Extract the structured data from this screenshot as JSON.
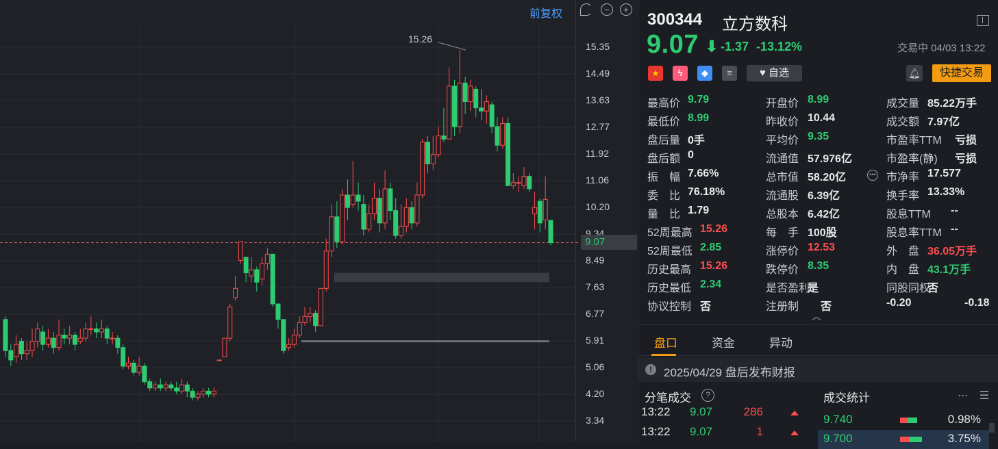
{
  "chart": {
    "restore_label": "前复权",
    "y_ticks": [
      "15.35",
      "14.49",
      "13.63",
      "12.77",
      "11.92",
      "11.06",
      "10.20",
      "9.34",
      "8.49",
      "7.63",
      "6.77",
      "5.91",
      "5.06",
      "4.20",
      "3.34"
    ],
    "current_price_tag": "9.07",
    "peak_label": "15.26",
    "up_color": "#ff4d4f",
    "down_color": "#2ecc71"
  },
  "chart_data": {
    "type": "candlestick",
    "y_range": [
      3.34,
      15.35
    ],
    "candles": [
      [
        6.6,
        5.6,
        6.7,
        5.4
      ],
      [
        5.6,
        5.3,
        5.8,
        5.1
      ],
      [
        5.4,
        5.8,
        6.1,
        5.2
      ],
      [
        5.9,
        5.5,
        6.0,
        5.3
      ],
      [
        5.5,
        5.6,
        5.9,
        5.3
      ],
      [
        5.6,
        5.9,
        6.3,
        5.4
      ],
      [
        5.9,
        6.3,
        6.5,
        5.7
      ],
      [
        6.2,
        5.8,
        6.4,
        5.6
      ],
      [
        5.8,
        6.0,
        6.3,
        5.7
      ],
      [
        6.0,
        5.7,
        6.2,
        5.5
      ],
      [
        5.7,
        6.1,
        6.6,
        5.6
      ],
      [
        6.1,
        6.0,
        6.3,
        5.8
      ],
      [
        6.0,
        6.1,
        6.4,
        5.8
      ],
      [
        6.1,
        5.8,
        6.2,
        5.6
      ],
      [
        5.9,
        6.0,
        6.3,
        5.8
      ],
      [
        6.0,
        6.3,
        6.5,
        5.9
      ],
      [
        6.3,
        6.3,
        6.7,
        6.1
      ],
      [
        6.3,
        6.2,
        6.5,
        6.0
      ],
      [
        6.2,
        6.3,
        6.6,
        6.0
      ],
      [
        6.3,
        6.0,
        6.4,
        5.8
      ],
      [
        6.0,
        6.0,
        6.2,
        5.8
      ],
      [
        6.0,
        5.7,
        6.1,
        5.5
      ],
      [
        5.7,
        5.1,
        5.8,
        5.0
      ],
      [
        5.1,
        5.2,
        5.4,
        5.0
      ],
      [
        5.2,
        4.9,
        5.3,
        4.8
      ],
      [
        4.9,
        5.1,
        5.4,
        4.8
      ],
      [
        5.1,
        4.6,
        5.2,
        4.5
      ],
      [
        4.6,
        4.4,
        4.7,
        4.3
      ],
      [
        4.4,
        4.5,
        4.6,
        4.3
      ],
      [
        4.5,
        4.4,
        4.7,
        4.3
      ],
      [
        4.4,
        4.5,
        4.6,
        4.3
      ],
      [
        4.5,
        4.4,
        4.6,
        4.3
      ],
      [
        4.4,
        4.3,
        4.6,
        4.2
      ],
      [
        4.3,
        4.5,
        4.7,
        4.2
      ],
      [
        4.5,
        4.3,
        4.6,
        4.1
      ],
      [
        4.3,
        4.1,
        4.4,
        4.0
      ],
      [
        4.1,
        4.2,
        4.3,
        4.0
      ],
      [
        4.2,
        4.3,
        4.4,
        4.1
      ],
      [
        4.3,
        4.2,
        4.4,
        4.1
      ],
      [
        4.2,
        4.3,
        4.4,
        4.1
      ],
      [
        5.3,
        5.3,
        5.3,
        5.3
      ],
      [
        5.4,
        6.0,
        6.0,
        5.4
      ],
      [
        6.0,
        7.0,
        7.1,
        5.9
      ],
      [
        7.3,
        7.6,
        8.0,
        7.2
      ],
      [
        8.5,
        9.1,
        9.1,
        8.4
      ],
      [
        8.6,
        8.1,
        8.6,
        7.8
      ],
      [
        8.0,
        8.2,
        8.6,
        7.8
      ],
      [
        8.2,
        7.8,
        8.3,
        7.5
      ],
      [
        7.9,
        8.4,
        8.6,
        7.7
      ],
      [
        8.4,
        8.7,
        8.9,
        8.2
      ],
      [
        8.7,
        7.1,
        8.7,
        7.0
      ],
      [
        7.1,
        6.6,
        7.1,
        6.3
      ],
      [
        6.6,
        5.6,
        6.6,
        5.5
      ],
      [
        5.7,
        5.8,
        6.0,
        5.6
      ],
      [
        5.8,
        6.1,
        6.3,
        5.7
      ],
      [
        6.1,
        6.5,
        6.7,
        6.0
      ],
      [
        6.5,
        6.7,
        7.0,
        6.4
      ],
      [
        6.7,
        6.8,
        7.0,
        6.5
      ],
      [
        6.8,
        6.4,
        6.9,
        6.2
      ],
      [
        6.4,
        7.6,
        7.6,
        6.4
      ],
      [
        7.6,
        8.8,
        9.2,
        7.5
      ],
      [
        8.8,
        9.9,
        10.3,
        8.6
      ],
      [
        9.9,
        9.1,
        10.4,
        8.9
      ],
      [
        9.1,
        10.6,
        10.8,
        9.0
      ],
      [
        10.6,
        10.2,
        11.1,
        9.8
      ],
      [
        10.3,
        10.6,
        11.7,
        10.2
      ],
      [
        10.6,
        10.4,
        11.0,
        10.1
      ],
      [
        10.3,
        9.5,
        10.6,
        9.3
      ],
      [
        9.5,
        10.0,
        10.3,
        9.4
      ],
      [
        10.0,
        10.5,
        11.0,
        9.8
      ],
      [
        10.5,
        9.7,
        10.8,
        9.4
      ],
      [
        9.7,
        10.8,
        11.4,
        9.5
      ],
      [
        10.8,
        10.1,
        11.0,
        9.8
      ],
      [
        10.1,
        9.3,
        10.5,
        9.2
      ],
      [
        9.3,
        9.6,
        10.3,
        9.2
      ],
      [
        9.6,
        10.2,
        10.5,
        9.4
      ],
      [
        10.2,
        9.7,
        10.4,
        9.5
      ],
      [
        9.7,
        10.6,
        11.0,
        9.6
      ],
      [
        10.6,
        12.3,
        12.4,
        10.5
      ],
      [
        12.3,
        11.6,
        12.5,
        11.3
      ],
      [
        11.6,
        11.9,
        12.5,
        11.4
      ],
      [
        11.9,
        12.5,
        12.8,
        11.8
      ],
      [
        12.5,
        12.4,
        13.4,
        12.3
      ],
      [
        12.4,
        14.1,
        14.7,
        12.4
      ],
      [
        14.1,
        12.8,
        14.3,
        12.5
      ],
      [
        12.8,
        14.2,
        15.26,
        12.6
      ],
      [
        14.2,
        13.6,
        14.4,
        13.2
      ],
      [
        13.6,
        14.1,
        14.3,
        13.3
      ],
      [
        14.0,
        13.4,
        14.1,
        13.1
      ],
      [
        13.4,
        13.3,
        14.0,
        13.0
      ],
      [
        13.3,
        13.6,
        13.8,
        12.9
      ],
      [
        13.5,
        12.8,
        13.6,
        12.6
      ],
      [
        12.8,
        12.2,
        13.1,
        12.0
      ],
      [
        12.2,
        12.9,
        13.1,
        12.1
      ],
      [
        12.9,
        10.9,
        13.1,
        10.9
      ],
      [
        10.9,
        11.0,
        11.3,
        10.8
      ],
      [
        11.0,
        11.0,
        11.2,
        10.7
      ],
      [
        10.9,
        11.2,
        11.5,
        10.8
      ],
      [
        11.2,
        10.8,
        11.3,
        10.7
      ],
      [
        10.0,
        10.2,
        10.7,
        9.5
      ],
      [
        10.4,
        9.7,
        10.5,
        9.4
      ],
      [
        9.8,
        10.46,
        11.2,
        9.5
      ],
      [
        9.79,
        9.07,
        9.79,
        8.99
      ]
    ],
    "price_lines": [
      9.07
    ],
    "shaded_bands": [
      [
        7.8,
        8.1
      ]
    ],
    "support_line": 5.9
  },
  "header": {
    "code": "300344",
    "name": "立方数科",
    "price": "9.07",
    "arrow": "⬇",
    "change": "-1.37",
    "change_pct": "-13.12%",
    "status": "交易中 04/03 13:22",
    "watch_label": "自选",
    "quick_trade_label": "快捷交易"
  },
  "stats": [
    [
      {
        "l": "最高价",
        "v": "9.79",
        "c": "g"
      },
      {
        "l": "开盘价",
        "v": "8.99",
        "c": "g"
      },
      {
        "l": "成交量",
        "v": "85.22万手",
        "c": "w"
      }
    ],
    [
      {
        "l": "最低价",
        "v": "8.99",
        "c": "g"
      },
      {
        "l": "昨收价",
        "v": "10.44",
        "c": "w"
      },
      {
        "l": "成交额",
        "v": "7.97亿",
        "c": "w"
      }
    ],
    [
      {
        "l": "盘后量",
        "v": "0手",
        "c": "w"
      },
      {
        "l": "平均价",
        "v": "9.35",
        "c": "g"
      },
      {
        "l": "市盈率TTM",
        "v": "亏损",
        "c": "w"
      }
    ],
    [
      {
        "l": "盘后额",
        "v": "0",
        "c": "w"
      },
      {
        "l": "流通值",
        "v": "57.976亿",
        "c": "w"
      },
      {
        "l": "市盈率(静)",
        "v": "亏损",
        "c": "w"
      }
    ],
    [
      {
        "l": "振　幅",
        "v": "7.66%",
        "c": "w"
      },
      {
        "l": "总市值",
        "v": "58.20亿",
        "c": "w"
      },
      {
        "l": "市净率",
        "v": "17.577",
        "c": "w"
      }
    ],
    [
      {
        "l": "委　比",
        "v": "76.18%",
        "c": "w"
      },
      {
        "l": "流通股",
        "v": "6.39亿",
        "c": "w"
      },
      {
        "l": "换手率",
        "v": "13.33%",
        "c": "w"
      }
    ],
    [
      {
        "l": "量　比",
        "v": "1.79",
        "c": "w"
      },
      {
        "l": "总股本",
        "v": "6.42亿",
        "c": "w"
      },
      {
        "l": "股息TTM",
        "v": "--",
        "c": "w"
      }
    ],
    [
      {
        "l": "52周最高",
        "v": "15.26",
        "c": "r"
      },
      {
        "l": "每　手",
        "v": "100股",
        "c": "w"
      },
      {
        "l": "股息率TTM",
        "v": "--",
        "c": "w"
      }
    ],
    [
      {
        "l": "52周最低",
        "v": "2.85",
        "c": "g"
      },
      {
        "l": "涨停价",
        "v": "12.53",
        "c": "r"
      },
      {
        "l": "外　盘",
        "v": "36.05万手",
        "c": "r"
      }
    ],
    [
      {
        "l": "历史最高",
        "v": "15.26",
        "c": "r"
      },
      {
        "l": "跌停价",
        "v": "8.35",
        "c": "g"
      },
      {
        "l": "内　盘",
        "v": "43.1万手",
        "c": "g"
      }
    ],
    [
      {
        "l": "历史最低",
        "v": "2.34",
        "c": "g"
      },
      {
        "l": "是否盈利",
        "v": "是",
        "c": "w"
      },
      {
        "l": "同股同权",
        "v": "否",
        "c": "w"
      }
    ],
    [
      {
        "l": "协议控制",
        "v": "否",
        "c": "w"
      },
      {
        "l": "注册制",
        "v": "否",
        "c": "w"
      },
      {
        "l": "-0.20",
        "v": "-0.18",
        "c": "w"
      }
    ]
  ],
  "tabs": [
    "盘口",
    "资金",
    "异动"
  ],
  "notice": "2025/04/29  盘后发布财报",
  "ticks_title": "分笔成交",
  "ticks": [
    {
      "time": "13:22",
      "price": "9.07",
      "vol": "286"
    },
    {
      "time": "13:22",
      "price": "9.07",
      "vol": "1"
    }
  ],
  "stats_title": "成交统计",
  "volume_stats": [
    {
      "price": "9.740",
      "pct": "0.98%",
      "red": 0.35,
      "green": 0.45
    },
    {
      "price": "9.700",
      "pct": "3.75%",
      "red": 0.4,
      "green": 0.6
    }
  ]
}
